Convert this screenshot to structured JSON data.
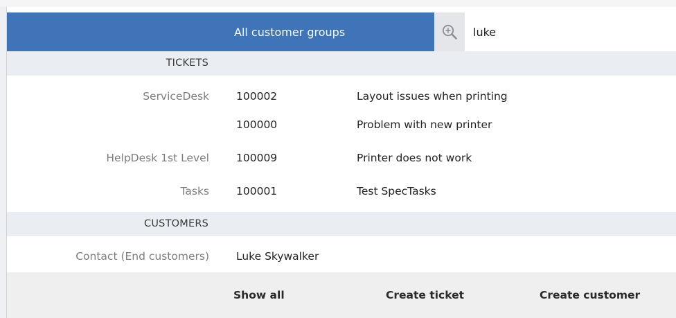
{
  "header": {
    "group_label": "All customer groups",
    "search_icon": "zoom-in-icon",
    "search_value": "luke"
  },
  "tickets": {
    "section_label": "TICKETS",
    "rows": [
      {
        "category": "ServiceDesk",
        "number": "100002",
        "subject": "Layout issues when printing"
      },
      {
        "category": "",
        "number": "100000",
        "subject": "Problem with new printer"
      },
      {
        "category": "HelpDesk 1st Level",
        "number": "100009",
        "subject": "Printer does not work"
      },
      {
        "category": "Tasks",
        "number": "100001",
        "subject": "Test SpecTasks"
      }
    ]
  },
  "customers": {
    "section_label": "CUSTOMERS",
    "rows": [
      {
        "category": "Contact (End customers)",
        "name": "Luke Skywalker"
      }
    ]
  },
  "footer": {
    "show_all": "Show all",
    "create_ticket": "Create ticket",
    "create_customer": "Create customer"
  },
  "colors": {
    "header_bg": "#3f74b8",
    "section_bg": "#eaeef3",
    "footer_bg": "#efefef"
  }
}
